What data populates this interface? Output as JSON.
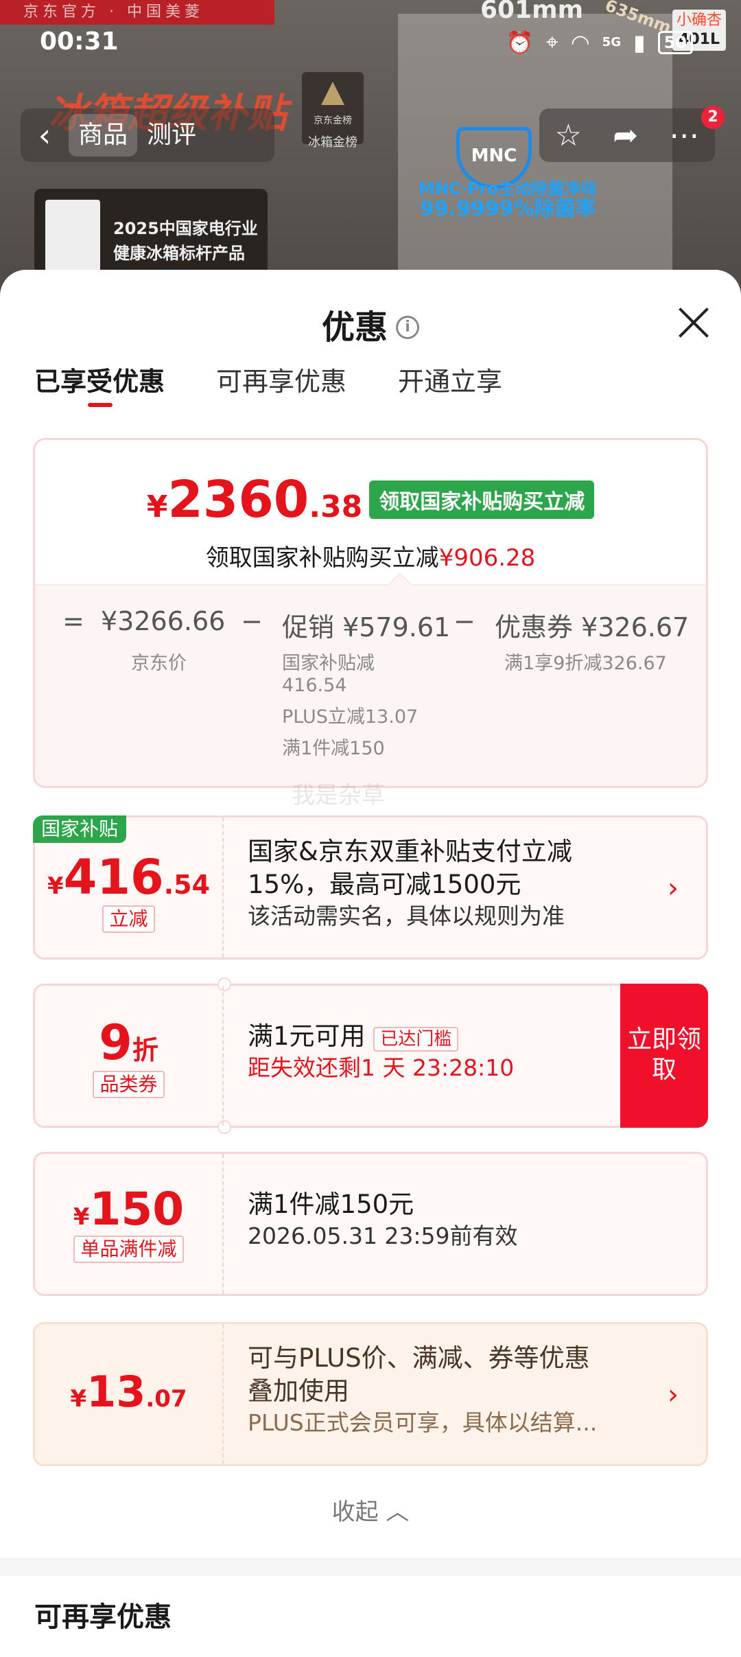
{
  "status_bar": {
    "time": "00:31",
    "battery": "50",
    "network": "5G"
  },
  "background": {
    "banner": "京东官方 · 中国美菱",
    "dimension_top": "601mm",
    "dimension_side": "635mm",
    "corner_note_1": "小确杏",
    "corner_note_2": "401L",
    "headline": "冰箱超级补贴",
    "cert_line1": "2025中国家电行业",
    "cert_line2": "健康冰箱标杆产品",
    "badge_brand": "京东金榜",
    "badge_label": "冰箱金榜",
    "mnc_label": "MNC·Pro主动除菌净味",
    "mnc_rate": "99.9999%除菌率",
    "shield_text": "MNC"
  },
  "nav": {
    "tab_product": "商品",
    "tab_review": "测评",
    "cart_badge": "2"
  },
  "sheet": {
    "title": "优惠",
    "tabs": [
      {
        "label": "已享受优惠"
      },
      {
        "label": "可再享优惠"
      },
      {
        "label": "开通立享"
      }
    ],
    "summary": {
      "currency": "¥",
      "price_int": "2360",
      "price_dec": ".38",
      "chip": "领取国家补贴购买立减",
      "save_prefix": "领取国家补贴购买立减",
      "save_amount": "¥906.28",
      "eq": "=",
      "jd_price": "¥3266.66",
      "jd_price_label": "京东价",
      "minus": "−",
      "promo_value": "促销 ¥579.61",
      "promo_detail_1": "国家补贴减",
      "promo_detail_2": "416.54",
      "promo_detail_3": "PLUS立减13.07",
      "promo_detail_4": "满1件减150",
      "coupon_value": "优惠券 ¥326.67",
      "coupon_detail": "满1享9折减326.67"
    },
    "watermark": "我是杂草",
    "cards": [
      {
        "ribbon": "国家补贴",
        "cur": "¥",
        "int": "416",
        "dec": ".54",
        "tag": "立减",
        "line1": "国家&京东双重补贴支付立减",
        "line2": "15%，最高可减1500元",
        "line3": "该活动需实名，具体以规则为准"
      },
      {
        "int": "9",
        "unit": "折",
        "tag": "品类券",
        "line1": "满1元可用",
        "badge": "已达门槛",
        "line2": "距失效还剩1 天 23:28:10",
        "claim": "立即领取"
      },
      {
        "cur": "¥",
        "int": "150",
        "tag": "单品满件减",
        "line1": "满1件减150元",
        "line2": "2026.05.31 23:59前有效"
      },
      {
        "cur": "¥",
        "int": "13",
        "dec": ".07",
        "line1": "可与PLUS价、满减、券等优惠",
        "line2": "叠加使用",
        "line3": "PLUS正式会员可享，具体以结算..."
      }
    ],
    "collapse_label": "收起",
    "more_section_title": "可再享优惠"
  },
  "colors": {
    "accent_red": "#e4131c",
    "gov_green": "#2da64b",
    "claim_red": "#f0102b"
  }
}
